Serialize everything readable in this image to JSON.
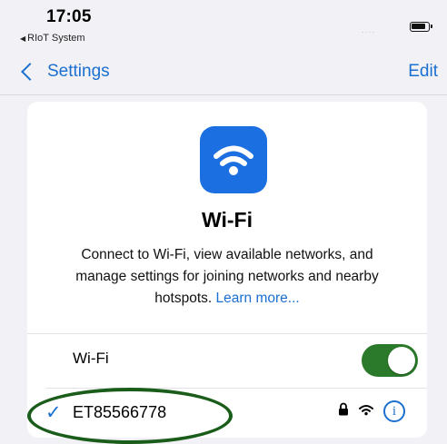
{
  "status": {
    "time": "17:05",
    "back_app": "RIoT System",
    "signal_dots": "....",
    "battery_icon": "battery-icon"
  },
  "nav": {
    "back_label": "Settings",
    "edit_label": "Edit"
  },
  "card": {
    "icon": "wifi-icon",
    "title": "Wi-Fi",
    "desc_line1": "Connect to Wi-Fi, view available networks, and",
    "desc_line2": "manage settings for joining networks and nearby",
    "desc_line3": "hotspots.",
    "learn_more": "Learn more...",
    "wifi_row_label": "Wi-Fi",
    "wifi_on": true,
    "network": {
      "checkmark": "✓",
      "name": "ET85566778",
      "secured": true,
      "info_glyph": "i"
    }
  },
  "colors": {
    "accent": "#1b6fd1",
    "icon_bg": "#1b6fe0",
    "toggle_on": "#2b7a2b",
    "highlight_ellipse": "#1a5c1a"
  }
}
